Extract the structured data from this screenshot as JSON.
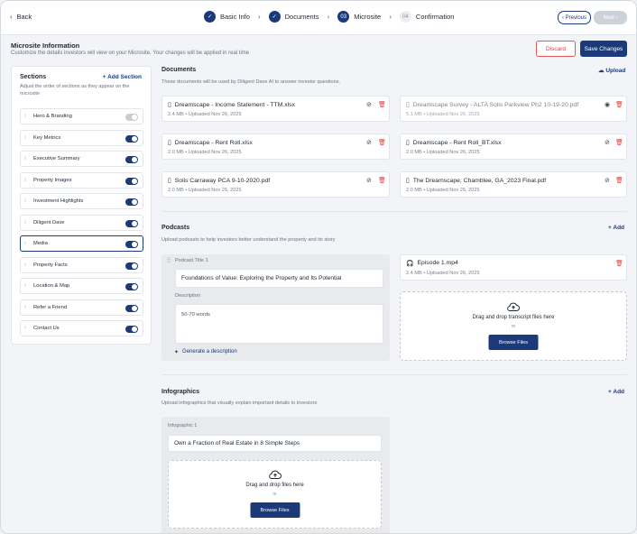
{
  "topbar": {
    "back": "Back",
    "steps": [
      {
        "num": "",
        "label": "Basic Info",
        "done": true
      },
      {
        "num": "",
        "label": "Documents",
        "done": true
      },
      {
        "num": "03",
        "label": "Microsite",
        "current": true
      },
      {
        "num": "04",
        "label": "Confirmation"
      }
    ],
    "previous": "Previous",
    "next": "Next"
  },
  "header": {
    "title": "Microsite Information",
    "subtitle": "Customize the details investors will view on your Microsite. Your changes will be applied in real time",
    "discard": "Discard",
    "save": "Save Changes"
  },
  "sections": {
    "title": "Sections",
    "add": "Add Section",
    "description": "Adjust the order of sections as they appear on the microsite",
    "items": [
      {
        "label": "Hero & Branding",
        "enabled": false
      },
      {
        "label": "Key Metrics",
        "enabled": true
      },
      {
        "label": "Executive Summary",
        "enabled": true
      },
      {
        "label": "Property Images",
        "enabled": true
      },
      {
        "label": "Investment Highlights",
        "enabled": true
      },
      {
        "label": "Diligent Dave",
        "enabled": true
      },
      {
        "label": "Media",
        "enabled": true,
        "active": true
      },
      {
        "label": "Property Facts",
        "enabled": true
      },
      {
        "label": "Location & Map",
        "enabled": true
      },
      {
        "label": "Refer a Friend",
        "enabled": true
      },
      {
        "label": "Contact Us",
        "enabled": true
      }
    ]
  },
  "documents": {
    "title": "Documents",
    "subtitle": "These documents will be used by Diligent Dave AI to answer investor questions.",
    "upload": "Upload",
    "files": [
      {
        "name": "Dreamscape - Income Statement - TTM.xlsx",
        "meta": "2.4 MB • Uploaded Nov 26, 2025",
        "hidden": true
      },
      {
        "name": "Dreamscape Survey - ALTA Solis Parkview Ph2 10-19-20.pdf",
        "meta": "5.1 MB • Uploaded Nov 26, 2025",
        "hidden": false,
        "dim": true
      },
      {
        "name": "Dreamscape - Rent Roll.xlsx",
        "meta": "2.0 MB • Uploaded Nov 26, 2025",
        "hidden": true
      },
      {
        "name": "Dreamscape - Rent Roll_BT.xlsx",
        "meta": "2.0 MB • Uploaded Nov 26, 2025",
        "hidden": true
      },
      {
        "name": "Solis Carraway PCA 9-10-2020.pdf",
        "meta": "2.0 MB • Uploaded Nov 26, 2025",
        "hidden": true
      },
      {
        "name": "The Dreamscape, Chamblee, GA_2023 Final.pdf",
        "meta": "2.0 MB • Uploaded Nov 26, 2025",
        "hidden": true
      }
    ]
  },
  "podcasts": {
    "title": "Podcasts",
    "subtitle": "Upload podcasts to help investors better understand the property and its story",
    "add": "Add",
    "item_label": "Podcast Title 1",
    "item_title": "Foundations of Value: Exploring the Property and Its Potential",
    "description_label": "Description",
    "description_placeholder": "50-70 words",
    "generate": "Generate a description",
    "episode_name": "Episode 1.mp4",
    "episode_meta": "2.4 MB • Uploaded Nov 26, 2025",
    "drop_text": "Drag and drop transcript files here",
    "drop_or": "or",
    "browse": "Browse Files"
  },
  "infographics": {
    "title": "Infographics",
    "subtitle": "Upload infographics that visually explain important details to investors",
    "add": "Add",
    "item_label": "Infographic 1",
    "item_title": "Own a Fraction of Real Estate in 8 Simple Steps",
    "drop_text": "Drag and drop files here",
    "drop_or": "or",
    "browse": "Browse Files"
  },
  "colors": {
    "primary": "#1c3a7a",
    "danger": "#d94141"
  }
}
